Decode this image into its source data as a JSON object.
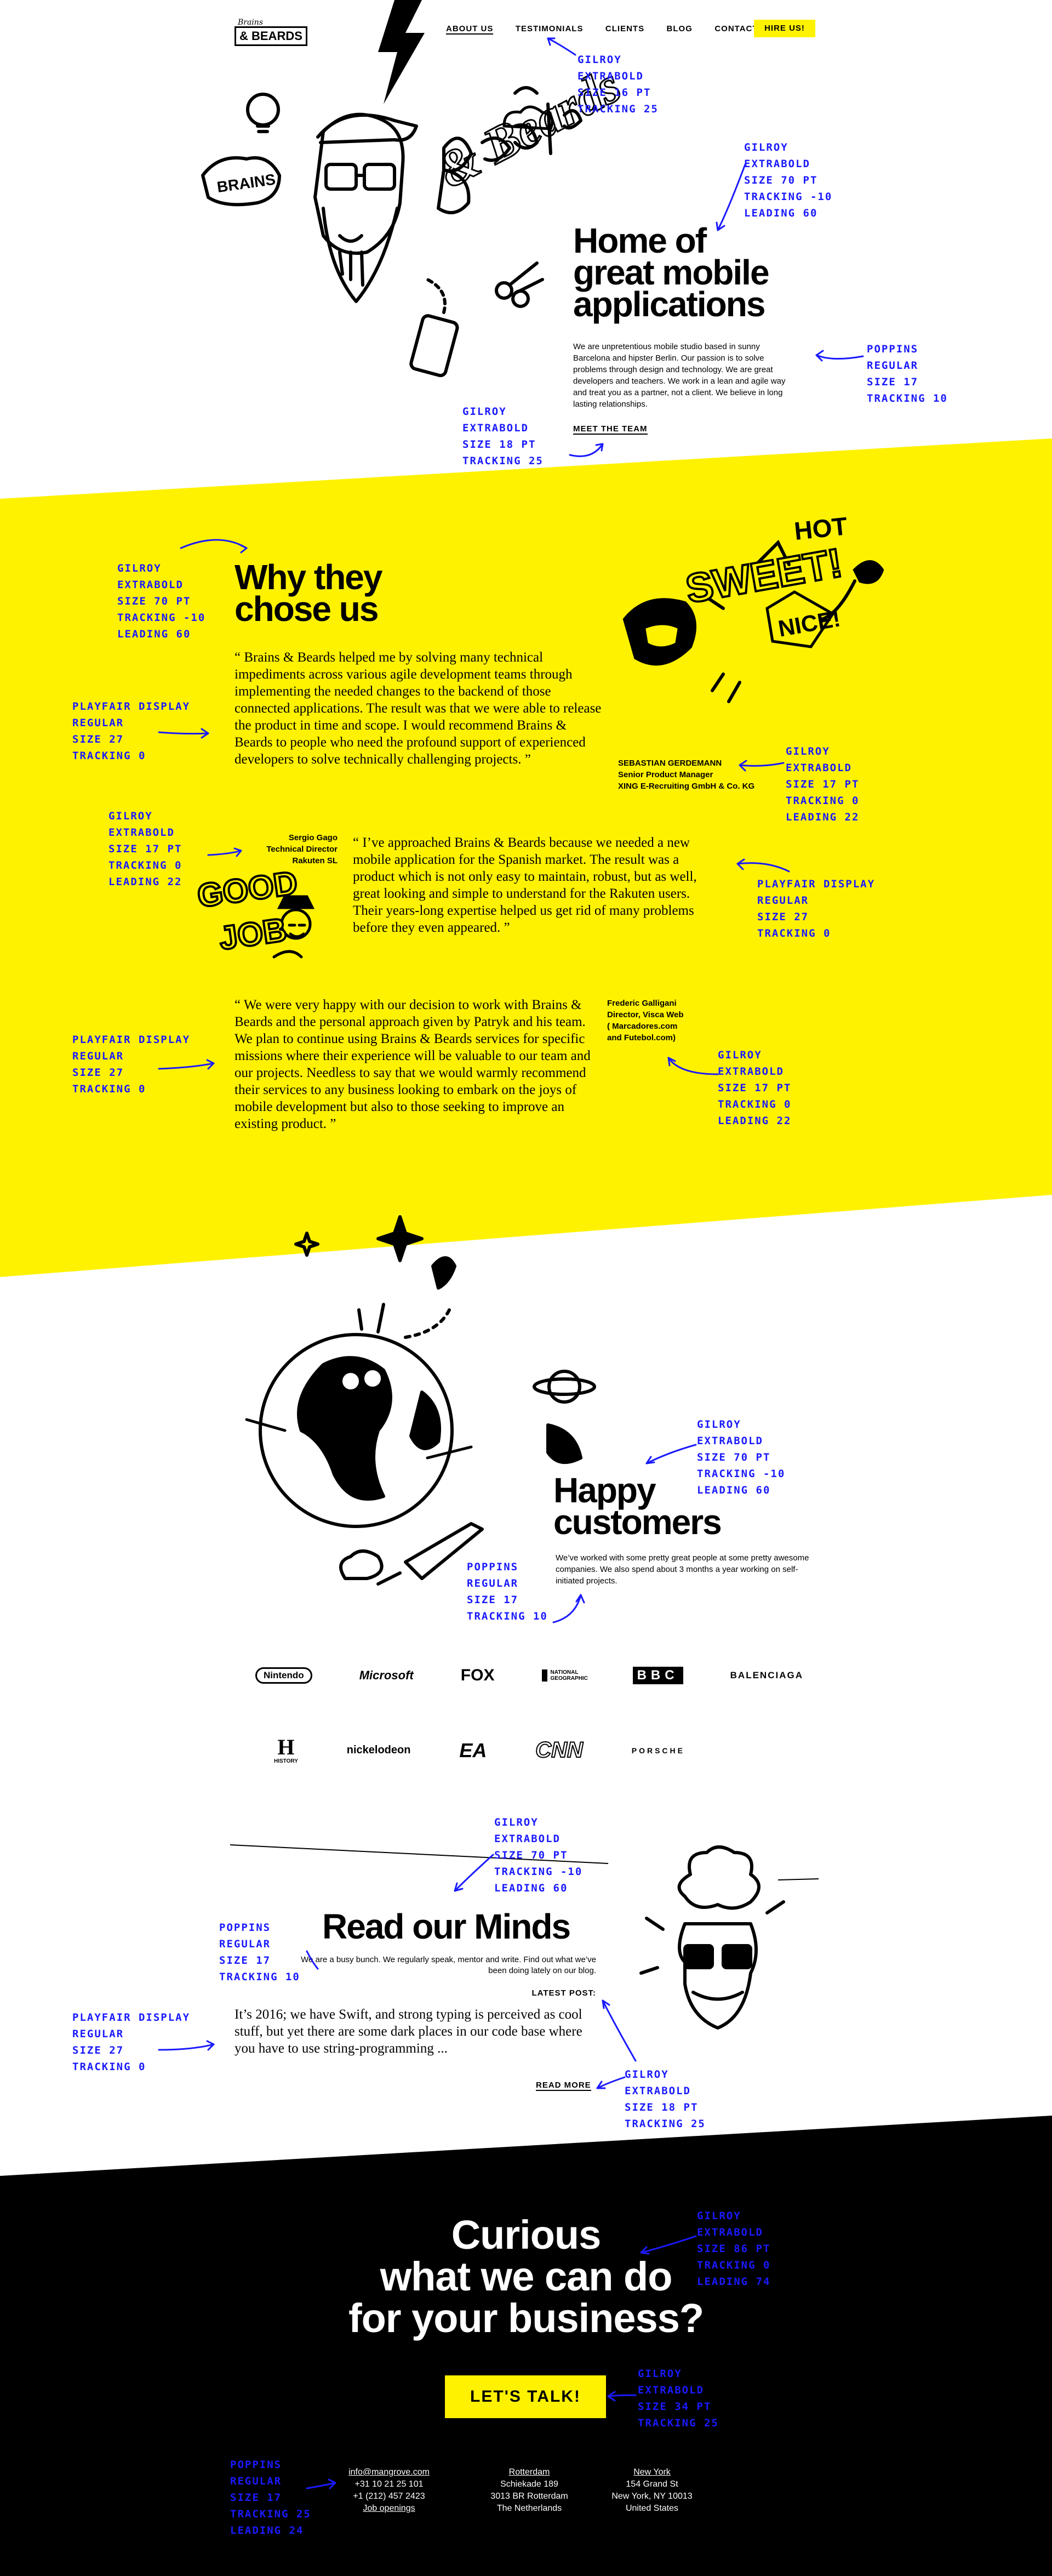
{
  "header": {
    "logo_top": "Brains",
    "logo_bottom": "BEARDS",
    "nav": [
      "ABOUT US",
      "TESTIMONIALS",
      "CLIENTS",
      "BLOG",
      "CONTACT US"
    ],
    "hire_label": "HIRE US!"
  },
  "hero": {
    "title_lines": [
      "Home of",
      "great mobile",
      "applications"
    ],
    "body": "We are unpretentious mobile studio based in sunny Barcelona and hipster Berlin. Our passion is to solve problems through design and technology. We are great developers and teachers. We work in a lean and agile way and treat you as a partner, not a client. We believe in long lasting relationships.",
    "cta": "MEET THE TEAM",
    "illustration_words": [
      "BRAINS",
      "& Beards"
    ]
  },
  "testimonials": {
    "title_lines": [
      "Why they",
      "chose us"
    ],
    "sticker_words": [
      "HOT",
      "SWEET!",
      "NICE!",
      "GOOD",
      "JOB"
    ],
    "items": [
      {
        "quote": "“ Brains & Beards helped me by solving many technical impediments across various agile development teams through implementing the needed changes to the backend of those connected applications. The result was that we were able to release the product in time and scope. I would recommend Brains & Beards to people who need the profound support of experienced developers to solve technically challenging projects. ”",
        "person": [
          "SEBASTIAN GERDEMANN",
          "Senior Product Manager",
          "XING E-Recruiting GmbH & Co. KG"
        ]
      },
      {
        "quote": "“ I’ve approached Brains & Beards because we needed a new mobile application for the Spanish market. The result was a product which is not only easy to maintain, robust, but as well, great looking and simple to understand for the Rakuten users. Their years-long expertise helped us get rid of many problems before they even appeared. ”",
        "person": [
          "Sergio Gago",
          "Technical Director",
          "Rakuten SL"
        ]
      },
      {
        "quote": "“ We were very happy with our decision to work with Brains & Beards and the personal approach given by Patryk and his team. We plan to continue using Brains & Beards services for specific missions where their experience will be valuable to our team and our projects. Needless to say that we would warmly recommend their services to any business looking to embark on the joys of mobile development but also to those seeking to improve an existing product. ”",
        "person": [
          "Frederic Galligani",
          "Director, Visca Web",
          "( Marcadores.com",
          "and Futebol.com)"
        ]
      }
    ]
  },
  "customers": {
    "title_lines": [
      "Happy",
      "customers"
    ],
    "body": "We’ve worked with some pretty great people at some pretty awesome companies. We also spend about 3 months a year working on self-initiated projects.",
    "logos_row1": [
      "Nintendo",
      "Microsoft",
      "FOX",
      "NATIONAL GEOGRAPHIC",
      "BBC",
      "BALENCIAGA"
    ],
    "logos_row2": [
      "HISTORY",
      "nickelodeon",
      "EA",
      "CNN",
      "PORSCHE"
    ]
  },
  "blog": {
    "title": "Read our Minds",
    "body": "We are a busy bunch. We regularly speak, mentor and write. Find out what we’ve been doing lately on our blog.",
    "latest_label": "LATEST POST:",
    "excerpt": "It’s 2016; we have Swift, and strong typing is perceived as cool stuff, but yet there are some dark places in our code base where you have to use string-programming ...",
    "read_more": "READ MORE"
  },
  "cta": {
    "title_lines": [
      "Curious",
      "what we can do",
      "for your business?"
    ],
    "button": "LET'S TALK!"
  },
  "footer": {
    "contact": [
      "info@mangrove.com",
      "+31 10 21 25 101",
      "+1 (212) 457 2423",
      "Job openings"
    ],
    "office1": [
      "Rotterdam",
      "Schiekade 189",
      "3013 BR Rotterdam",
      "The Netherlands"
    ],
    "office2": [
      "New York",
      "154 Grand St",
      "New York, NY 10013",
      "United States"
    ]
  },
  "annotations": {
    "nav_spec": [
      "Gilroy",
      "Extrabold",
      "size 16 pt",
      "tracking 25"
    ],
    "hero_title_spec": [
      "Gilroy",
      "Extrabold",
      "size 70 pt",
      "tracking -10",
      "leading 60"
    ],
    "hero_body_spec": [
      "Poppins",
      "Regular",
      "size 17",
      "tracking 10"
    ],
    "hero_cta_spec": [
      "Gilroy",
      "Extrabold",
      "size 18 pt",
      "tracking 25"
    ],
    "why_title_spec": [
      "Gilroy",
      "Extrabold",
      "size 70 pt",
      "tracking -10",
      "leading 60"
    ],
    "quote1_spec": [
      "Playfair Display",
      "Regular",
      "size 27",
      "tracking 0"
    ],
    "person1_spec": [
      "Gilroy",
      "Extrabold",
      "size 17 pt",
      "tracking 0",
      "leading 22"
    ],
    "person2_spec": [
      "Gilroy",
      "Extrabold",
      "size 17 pt",
      "tracking 0",
      "leading 22"
    ],
    "quote2_spec": [
      "Playfair Display",
      "Regular",
      "size 27",
      "tracking 0"
    ],
    "quote3_spec": [
      "Playfair Display",
      "Regular",
      "size 27",
      "tracking 0"
    ],
    "person3_spec": [
      "Gilroy",
      "Extrabold",
      "size 17 pt",
      "tracking 0",
      "leading 22"
    ],
    "customers_title_spec": [
      "Gilroy",
      "Extrabold",
      "size 70 pt",
      "tracking -10",
      "leading 60"
    ],
    "customers_body_spec": [
      "Poppins",
      "Regular",
      "size 17",
      "tracking 10"
    ],
    "blog_title_spec": [
      "Gilroy",
      "Extrabold",
      "size 70 pt",
      "tracking -10",
      "leading 60"
    ],
    "blog_body_spec": [
      "Poppins",
      "Regular",
      "size 17",
      "tracking 10"
    ],
    "blog_excerpt_spec": [
      "Playfair Display",
      "Regular",
      "size 27",
      "tracking 0"
    ],
    "blog_readmore_spec": [
      "Gilroy",
      "Extrabold",
      "size 18 pt",
      "tracking 25"
    ],
    "cta_title_spec": [
      "Gilroy",
      "Extrabold",
      "size 86 pt",
      "tracking 0",
      "leading 74"
    ],
    "cta_button_spec": [
      "Gilroy",
      "Extrabold",
      "size 34 pt",
      "tracking 25"
    ],
    "footer_spec": [
      "Poppins",
      "Regular",
      "size 17",
      "tracking 25",
      "leading 24"
    ]
  },
  "colors": {
    "yellow": "#fff200",
    "black": "#000000",
    "white": "#ffffff",
    "annotation_blue": "#1a1aff"
  }
}
